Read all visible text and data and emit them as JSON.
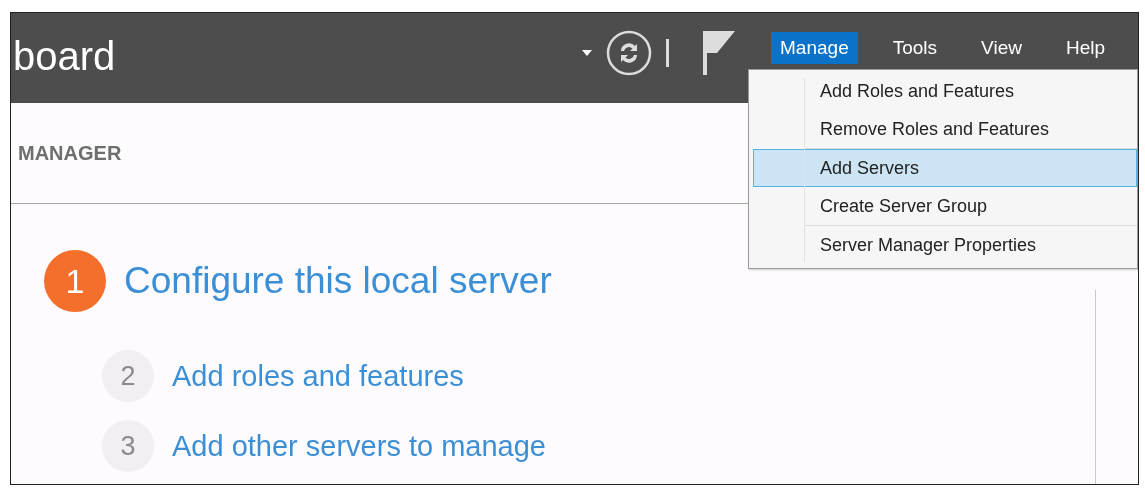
{
  "header": {
    "title": "board",
    "menubar": [
      {
        "label": "Manage",
        "selected": true
      },
      {
        "label": "Tools",
        "selected": false
      },
      {
        "label": "View",
        "selected": false
      },
      {
        "label": "Help",
        "selected": false
      }
    ]
  },
  "subheader": {
    "title": "MANAGER"
  },
  "menu": {
    "groups": [
      [
        {
          "label": "Add Roles and Features",
          "selected": false
        },
        {
          "label": "Remove Roles and Features",
          "selected": false
        }
      ],
      [
        {
          "label": "Add Servers",
          "selected": true
        },
        {
          "label": "Create Server Group",
          "selected": false
        }
      ],
      [
        {
          "label": "Server Manager Properties",
          "selected": false
        }
      ]
    ]
  },
  "steps": [
    {
      "number": "1",
      "label": "Configure this local server",
      "kind": "primary"
    },
    {
      "number": "2",
      "label": "Add roles and features",
      "kind": "secondary"
    },
    {
      "number": "3",
      "label": "Add other servers to manage",
      "kind": "secondary"
    }
  ]
}
